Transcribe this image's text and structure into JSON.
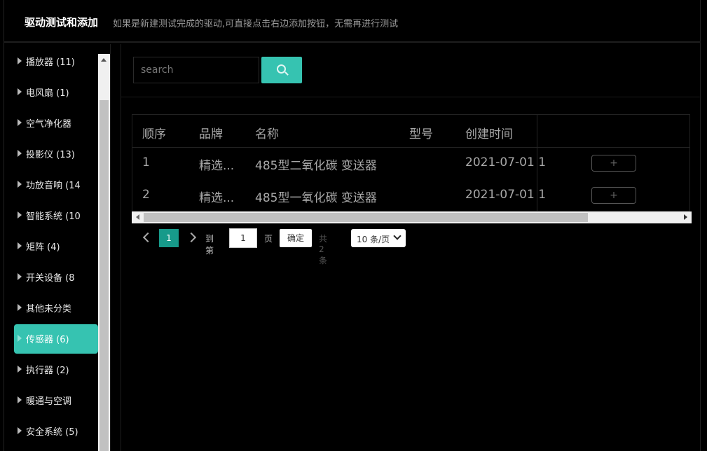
{
  "header": {
    "title": "驱动测试和添加",
    "hint": "如果是新建测试完成的驱动,可直接点击右边添加按钮，无需再进行测试"
  },
  "sidebar": {
    "items": [
      {
        "label": "播放器 (11)"
      },
      {
        "label": "电风扇 (1)"
      },
      {
        "label": "空气净化器"
      },
      {
        "label": "投影仪 (13)"
      },
      {
        "label": "功放音响 (14"
      },
      {
        "label": "智能系统 (10"
      },
      {
        "label": "矩阵 (4)"
      },
      {
        "label": "开关设备 (8"
      },
      {
        "label": "其他未分类"
      },
      {
        "label": "传感器 (6)",
        "active": true
      },
      {
        "label": "执行器 (2)"
      },
      {
        "label": "暖通与空调"
      },
      {
        "label": "安全系统 (5)"
      }
    ]
  },
  "search": {
    "placeholder": "search",
    "button_icon": "search-icon"
  },
  "table": {
    "columns": [
      "顺序",
      "品牌",
      "名称",
      "型号",
      "创建时间"
    ],
    "rows": [
      {
        "index": "1",
        "brand": "精选...",
        "name": "485型二氧化碳 变送器",
        "model": "",
        "created": "2021-07-01 1",
        "action": "+"
      },
      {
        "index": "2",
        "brand": "精选...",
        "name": "485型一氧化碳 变送器",
        "model": "",
        "created": "2021-07-01 1",
        "action": "+"
      }
    ]
  },
  "pagination": {
    "current_page": "1",
    "goto_label": "到第",
    "goto_value": "1",
    "page_label": "页",
    "confirm_label": "确定",
    "total_label": "共 2 条",
    "page_size": "10 条/页"
  },
  "colors": {
    "accent": "#36c3b1",
    "active_page": "#179a8a",
    "background": "#000000"
  }
}
